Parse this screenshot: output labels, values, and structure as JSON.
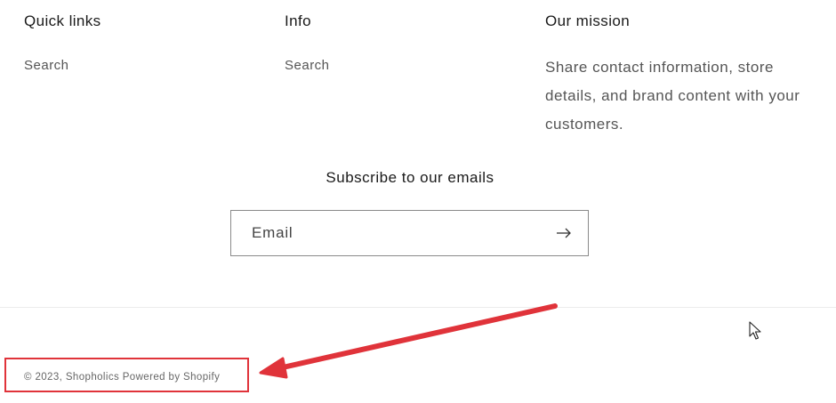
{
  "footer": {
    "columns": [
      {
        "heading": "Quick links",
        "links": [
          "Search"
        ]
      },
      {
        "heading": "Info",
        "links": [
          "Search"
        ]
      },
      {
        "heading": "Our mission",
        "text": "Share contact information, store details, and brand content with your customers."
      }
    ],
    "newsletter": {
      "heading": "Subscribe to our emails",
      "email_placeholder": "Email",
      "submit_icon": "arrow-right-icon"
    },
    "copyright": {
      "prefix": "© 2023,",
      "store_name": "Shopholics",
      "powered_by": "Powered by Shopify"
    }
  },
  "annotation": {
    "color": "#e0333a",
    "highlight": "copyright",
    "arrow": "arrow-pointing-left"
  }
}
